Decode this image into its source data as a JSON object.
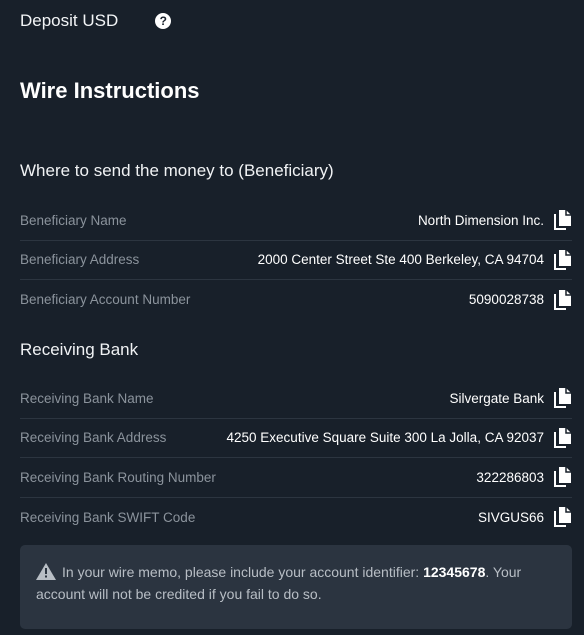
{
  "header": {
    "title": "Deposit USD",
    "help_icon": "question-circle-icon"
  },
  "page_title": "Wire Instructions",
  "beneficiary": {
    "title": "Where to send the money to (Beneficiary)",
    "rows": [
      {
        "label": "Beneficiary Name",
        "value": "North Dimension Inc."
      },
      {
        "label": "Beneficiary Address",
        "value": "2000 Center Street Ste 400 Berkeley, CA 94704"
      },
      {
        "label": "Beneficiary Account Number",
        "value": "5090028738"
      }
    ]
  },
  "bank": {
    "title": "Receiving Bank",
    "rows": [
      {
        "label": "Receiving Bank Name",
        "value": "Silvergate Bank"
      },
      {
        "label": "Receiving Bank Address",
        "value": "4250 Executive Square Suite 300 La Jolla, CA 92037"
      },
      {
        "label": "Receiving Bank Routing Number",
        "value": "322286803"
      },
      {
        "label": "Receiving Bank SWIFT Code",
        "value": "SIVGUS66"
      }
    ]
  },
  "notice": {
    "icon": "warning-triangle-icon",
    "text_before": "In your wire memo, please include your account identifier: ",
    "identifier": "12345678",
    "text_after": ". Your account will not be credited if you fail to do so."
  },
  "colors": {
    "background": "#18202a",
    "notice_bg": "#2b3440",
    "label": "#8b939c",
    "divider": "#2c3540"
  }
}
